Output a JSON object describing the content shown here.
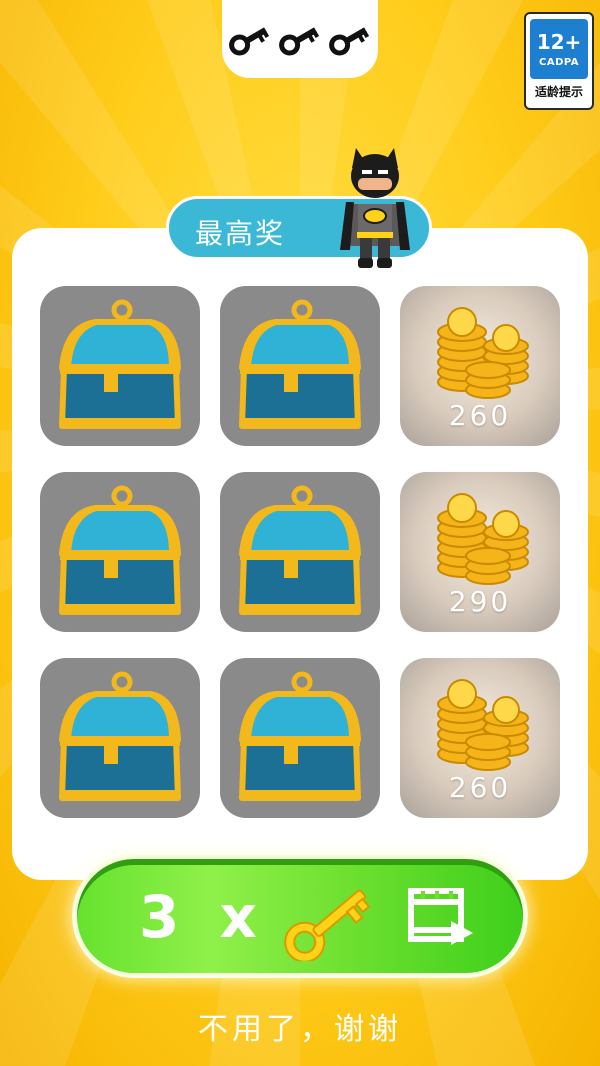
{
  "keys": {
    "count": 3,
    "icons": [
      "key-icon",
      "key-icon",
      "key-icon"
    ]
  },
  "age_rating": {
    "rating": "12+",
    "org": "CADPA",
    "tip": "适龄提示"
  },
  "prize_banner": {
    "label": "最高奖"
  },
  "grid": {
    "rows": [
      [
        {
          "type": "chest"
        },
        {
          "type": "chest"
        },
        {
          "type": "coins",
          "amount": "260"
        }
      ],
      [
        {
          "type": "chest"
        },
        {
          "type": "chest"
        },
        {
          "type": "coins",
          "amount": "290"
        }
      ],
      [
        {
          "type": "chest"
        },
        {
          "type": "chest"
        },
        {
          "type": "coins",
          "amount": "260"
        }
      ]
    ]
  },
  "action": {
    "multiplier": "3 x",
    "icons": [
      "key-icon",
      "video-ad-icon"
    ]
  },
  "decline": {
    "label": "不用了，谢谢"
  },
  "colors": {
    "background": "#ffcc1a",
    "banner": "#3ab8d6",
    "button": "#6fe030",
    "tile": "#8a8a8a"
  }
}
